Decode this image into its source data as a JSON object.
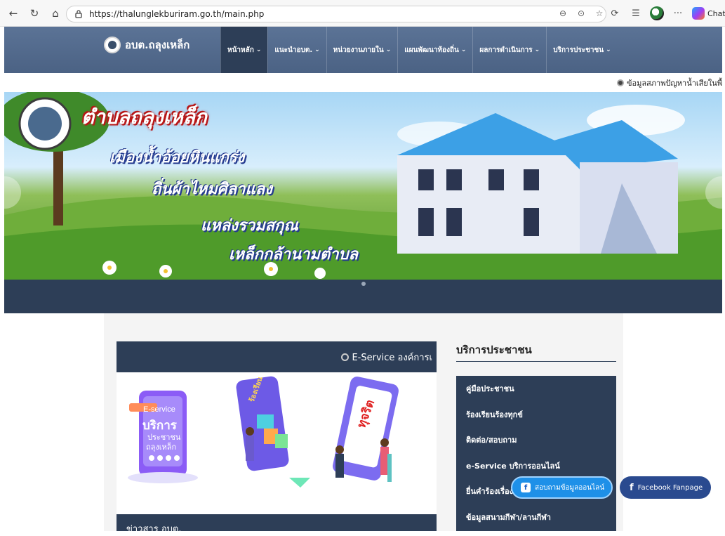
{
  "browser": {
    "url": "https://thalunglekburiram.go.th/main.php",
    "chat_label": "Chat"
  },
  "site": {
    "logo_text": "อบต.ถลุงเหล็ก",
    "menu": [
      {
        "label": "หน้าหลัก",
        "active": true
      },
      {
        "label": "แนะนำอบต.",
        "active": false
      },
      {
        "label": "หน่วยงานภายใน",
        "active": false
      },
      {
        "label": "แผนพัฒนาท้องถิ่น",
        "active": false
      },
      {
        "label": "ผลการดำเนินการ",
        "active": false
      },
      {
        "label": "บริการประชาชน",
        "active": false
      }
    ],
    "marquee_text": "ข้อมูลสภาพปัญหาน้ำเสียในพื้"
  },
  "banner": {
    "line1": "ตำบลถลุงเหล็ก",
    "line2": "เมืองน้ำอ้อยหินแกร่ง",
    "line3": "ถิ่นผ้าไหมศิลาแลง",
    "line4": "แหล่งรวมสกุณ",
    "line5": "เหล็กกล้านามตำบล"
  },
  "eservice": {
    "header": "E-Service องค์การเ",
    "phone_label": "E-service",
    "phone_title": "บริการ",
    "phone_sub1": "ประชาชน",
    "phone_sub2": "ถลุงเหล็ก",
    "tag1": "ร้องเรียน",
    "tag2": "ทุจริต"
  },
  "news": {
    "header": "ข่าวสาร อบต."
  },
  "sidebar": {
    "title": "บริการประชาชน",
    "items": [
      "คู่มือประชาชน",
      "ร้องเรียนร้องทุกข์",
      "ติดต่อ/สอบถาม",
      "e-Service บริการออนไลน์",
      "ยื่นคำร้องเรื่อง",
      "ข้อมูลสนามกีฬา/ลานกีฬา"
    ]
  },
  "floating": {
    "chat_label": "สอบถามข้อมูลออนไลน์",
    "fb_label": "Facebook Fanpage"
  }
}
